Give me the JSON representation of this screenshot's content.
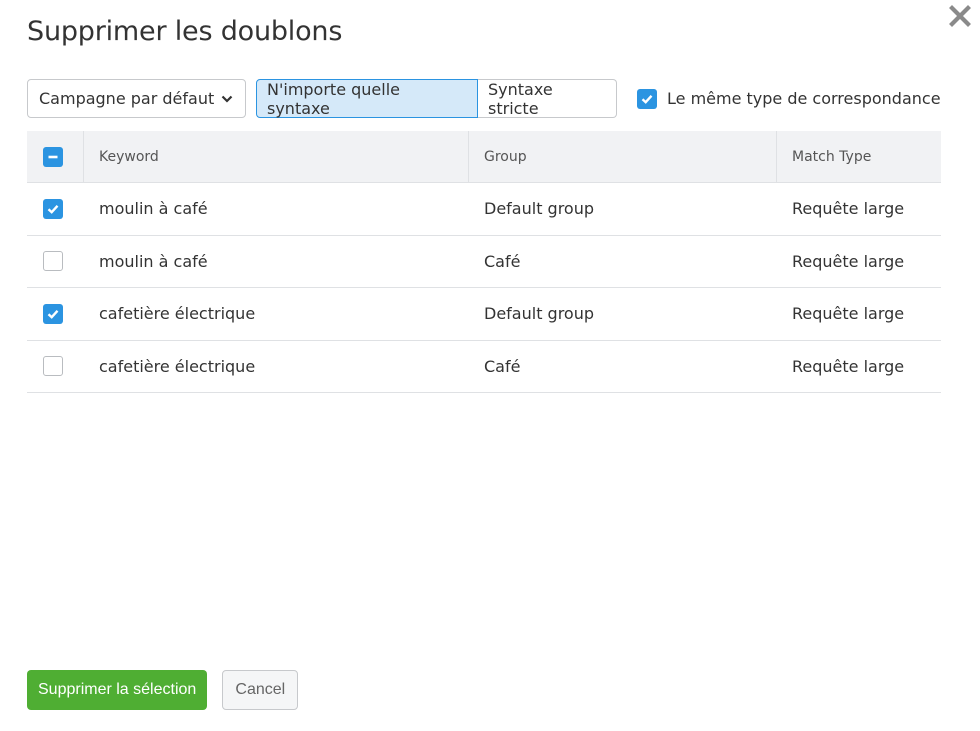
{
  "dialog": {
    "title": "Supprimer les doublons",
    "close_icon": "close-icon"
  },
  "toolbar": {
    "campaign_select": {
      "value": "Campagne par défaut",
      "icon": "chevron-down-icon"
    },
    "syntax_options": [
      {
        "label": "N'importe quelle syntaxe",
        "active": true
      },
      {
        "label": "Syntaxe stricte",
        "active": false
      }
    ],
    "same_match_type": {
      "label": "Le même type de correspondance",
      "checked": true
    }
  },
  "table": {
    "select_all_state": "partial",
    "columns": [
      "Keyword",
      "Group",
      "Match Type"
    ],
    "rows": [
      {
        "checked": true,
        "keyword": "moulin à café",
        "group": "Default group",
        "match_type": "Requête large"
      },
      {
        "checked": false,
        "keyword": "moulin à café",
        "group": "Café",
        "match_type": "Requête large"
      },
      {
        "checked": true,
        "keyword": "cafetière électrique",
        "group": "Default group",
        "match_type": "Requête large"
      },
      {
        "checked": false,
        "keyword": "cafetière électrique",
        "group": "Café",
        "match_type": "Requête large"
      }
    ]
  },
  "footer": {
    "delete_label": "Supprimer la sélection",
    "cancel_label": "Cancel"
  },
  "colors": {
    "accent_blue": "#2b94e1",
    "primary_green": "#4fae33",
    "active_segment_bg": "#d5e9f9",
    "header_bg": "#f1f2f4"
  }
}
